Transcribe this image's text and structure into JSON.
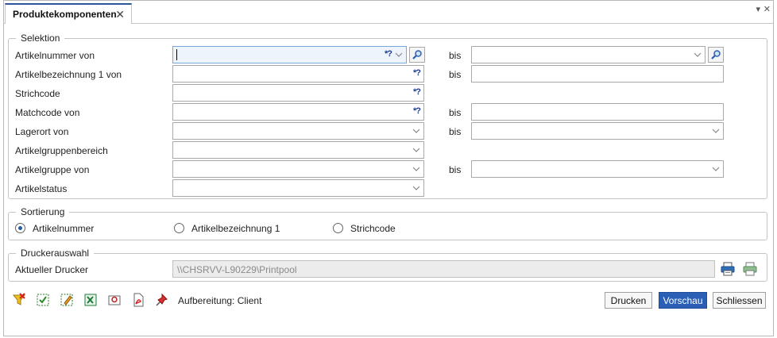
{
  "tab": {
    "title": "Produktekomponenten",
    "close": "✕"
  },
  "window_controls": {
    "dropdown": "▾",
    "close": "✕"
  },
  "selektion": {
    "title": "Selektion",
    "rows": [
      {
        "label": "Artikelnummer von",
        "wildcard": "*?",
        "to_label": "bis"
      },
      {
        "label": "Artikelbezeichnung 1 von",
        "wildcard": "*?",
        "to_label": "bis"
      },
      {
        "label": "Strichcode",
        "wildcard": "*?"
      },
      {
        "label": "Matchcode von",
        "wildcard": "*?",
        "to_label": "bis"
      },
      {
        "label": "Lagerort von",
        "to_label": "bis"
      },
      {
        "label": "Artikelgruppenbereich"
      },
      {
        "label": "Artikelgruppe von",
        "to_label": "bis"
      },
      {
        "label": "Artikelstatus"
      }
    ]
  },
  "sortierung": {
    "title": "Sortierung",
    "options": [
      "Artikelnummer",
      "Artikelbezeichnung 1",
      "Strichcode"
    ],
    "selected": "Artikelnummer"
  },
  "drucker": {
    "title": "Druckerauswahl",
    "label": "Aktueller Drucker",
    "value": "\\\\CHSRVV-L90229\\Printpool"
  },
  "footer": {
    "aufbereitung": "Aufbereitung: Client",
    "buttons": {
      "drucken": "Drucken",
      "vorschau": "Vorschau",
      "schliessen": "Schliessen"
    }
  },
  "colors": {
    "accent": "#2b5fb5",
    "tab_border": "#2b579a",
    "focus_bg": "#eef4fc"
  }
}
